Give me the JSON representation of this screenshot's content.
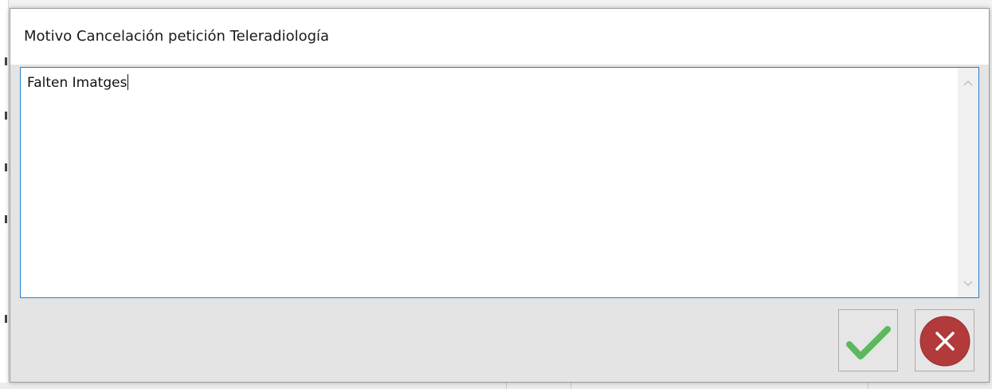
{
  "dialog": {
    "title": "Motivo Cancelación petición Teleradiología",
    "reason_text": "Falten Imatges"
  },
  "buttons": {
    "accept_icon": "green-check-icon",
    "cancel_icon": "red-close-circle-icon"
  },
  "colors": {
    "accent_border": "#1e7fd4",
    "check_green": "#5cb85c",
    "cancel_red": "#b23a3a"
  }
}
